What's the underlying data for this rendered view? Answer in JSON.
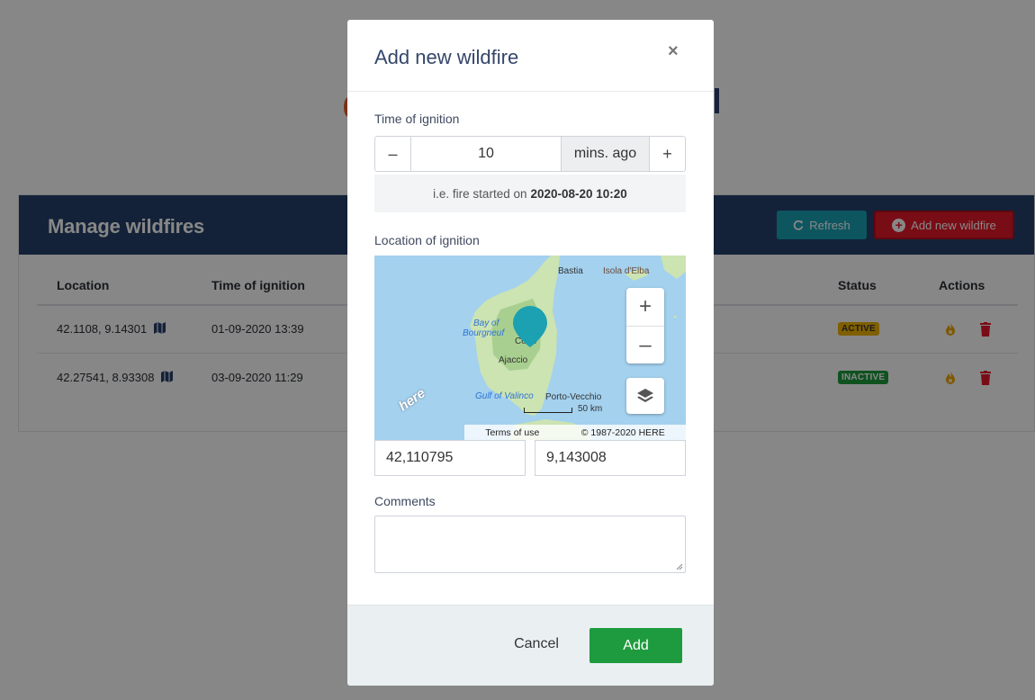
{
  "background": {
    "card_title": "Manage wildfires",
    "refresh_label": "Refresh",
    "add_new_label": "Add new wildfire",
    "columns": {
      "location": "Location",
      "time": "Time of ignition",
      "status": "Status",
      "actions": "Actions"
    },
    "rows": [
      {
        "location": "42.1108, 9.14301",
        "time": "01-09-2020 13:39",
        "status": "ACTIVE"
      },
      {
        "location": "42.27541, 8.93308",
        "time": "03-09-2020 11:29",
        "status": "INACTIVE"
      }
    ],
    "colors": {
      "header": "#24416b",
      "refresh": "#1aa3b5",
      "add_new": "#e5192b",
      "active": "#f1b400",
      "inactive": "#1e9b3e"
    }
  },
  "modal": {
    "title": "Add new wildfire",
    "close_glyph": "×",
    "time_label": "Time of ignition",
    "minus_glyph": "–",
    "plus_glyph": "+",
    "time_value": "10",
    "time_unit": "mins. ago",
    "hint_prefix": "i.e. fire started on",
    "hint_date": "2020-08-20 10:20",
    "location_label": "Location of ignition",
    "map": {
      "labels": {
        "bastia": "Bastia",
        "elba": "Isola d'Elba",
        "bay1": "Bay of",
        "bay2": "Bourgneuf",
        "corte": "Corte",
        "ajaccio": "Ajaccio",
        "valinco": "Gulf of Valinco",
        "porto": "Porto-Vecchio"
      },
      "zoom_in": "+",
      "zoom_out": "–",
      "scale": "50 km",
      "terms": "Terms of use",
      "copyright": "© 1987-2020 HERE",
      "logo": "here",
      "marker_color": "#1ba1b1"
    },
    "latitude": "42,110795",
    "longitude": "9,143008",
    "comments_label": "Comments",
    "comments_value": "",
    "cancel_label": "Cancel",
    "add_label": "Add",
    "colors": {
      "title": "#34466b",
      "add_button": "#1e9b3e",
      "footer_bg": "#eaf0f2"
    }
  }
}
